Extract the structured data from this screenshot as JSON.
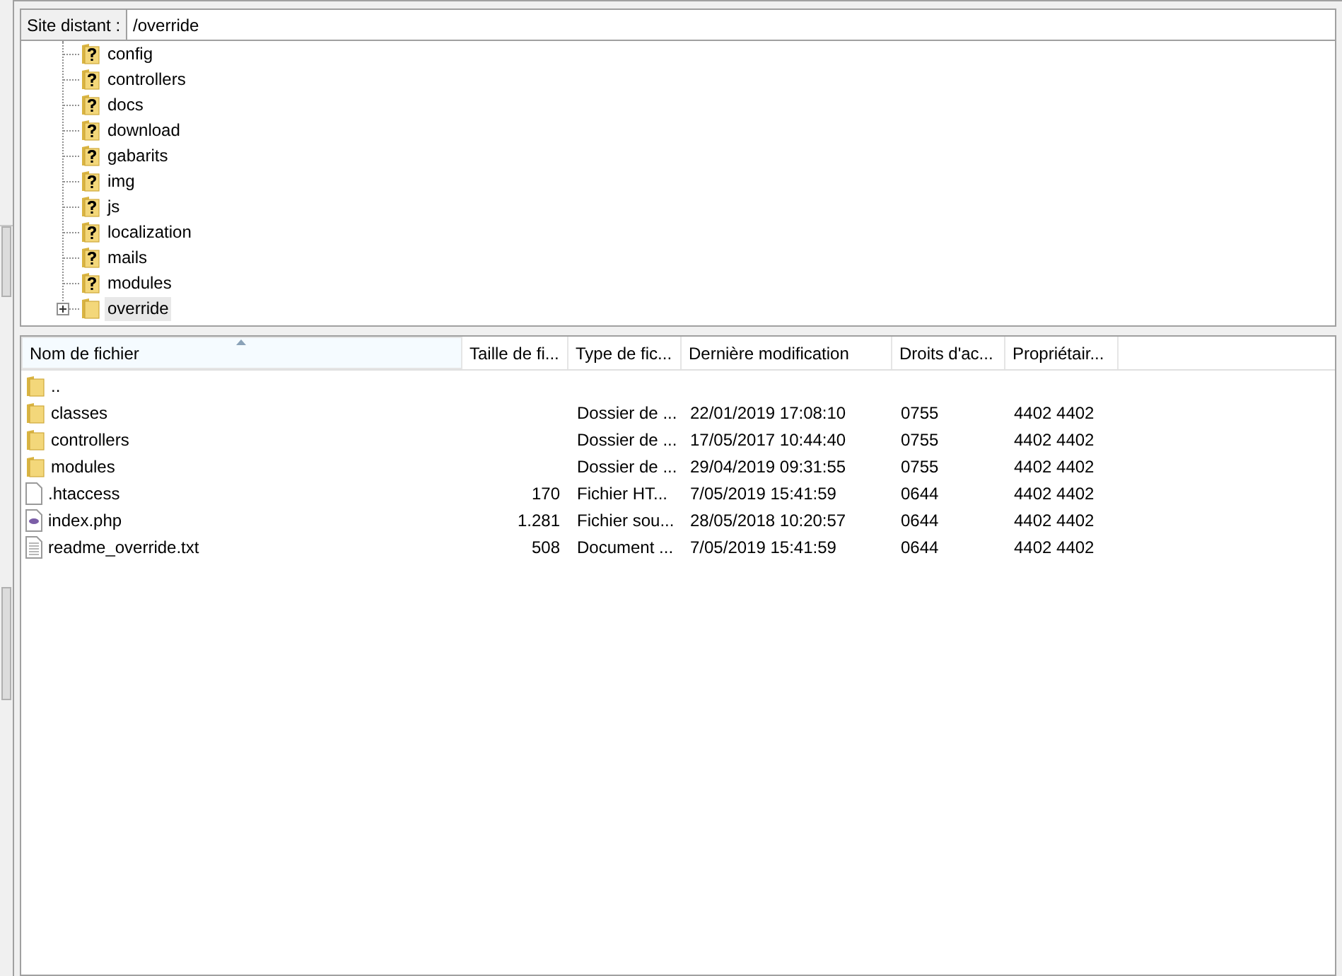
{
  "remote_site": {
    "label": "Site distant :",
    "path": "/override"
  },
  "tree": [
    {
      "name": "config",
      "kind": "unknown",
      "selected": false
    },
    {
      "name": "controllers",
      "kind": "unknown",
      "selected": false
    },
    {
      "name": "docs",
      "kind": "unknown",
      "selected": false
    },
    {
      "name": "download",
      "kind": "unknown",
      "selected": false
    },
    {
      "name": "gabarits",
      "kind": "unknown",
      "selected": false
    },
    {
      "name": "img",
      "kind": "unknown",
      "selected": false
    },
    {
      "name": "js",
      "kind": "unknown",
      "selected": false
    },
    {
      "name": "localization",
      "kind": "unknown",
      "selected": false
    },
    {
      "name": "mails",
      "kind": "unknown",
      "selected": false
    },
    {
      "name": "modules",
      "kind": "unknown",
      "selected": false
    },
    {
      "name": "override",
      "kind": "folder",
      "selected": true,
      "expandable": true
    }
  ],
  "file_list": {
    "columns": [
      {
        "label": "Nom de fichier",
        "sorted": true
      },
      {
        "label": "Taille de fi...",
        "sorted": false
      },
      {
        "label": "Type de fic...",
        "sorted": false
      },
      {
        "label": "Dernière modification",
        "sorted": false
      },
      {
        "label": "Droits d'ac...",
        "sorted": false
      },
      {
        "label": "Propriétair...",
        "sorted": false
      }
    ],
    "rows": [
      {
        "kind": "folder",
        "name": ".."
      },
      {
        "kind": "folder",
        "name": "classes",
        "type": "Dossier de ...",
        "modified": "22/01/2019 17:08:10",
        "rights": "0755",
        "owner": "4402 4402"
      },
      {
        "kind": "folder",
        "name": "controllers",
        "type": "Dossier de ...",
        "modified": "17/05/2017 10:44:40",
        "rights": "0755",
        "owner": "4402 4402"
      },
      {
        "kind": "folder",
        "name": "modules",
        "type": "Dossier de ...",
        "modified": "29/04/2019 09:31:55",
        "rights": "0755",
        "owner": "4402 4402"
      },
      {
        "kind": "file",
        "name": ".htaccess",
        "size": "170",
        "type": "Fichier HT...",
        "modified": "7/05/2019 15:41:59",
        "rights": "0644",
        "owner": "4402 4402"
      },
      {
        "kind": "php",
        "name": "index.php",
        "size": "1.281",
        "type": "Fichier sou...",
        "modified": "28/05/2018 10:20:57",
        "rights": "0644",
        "owner": "4402 4402"
      },
      {
        "kind": "text",
        "name": "readme_override.txt",
        "size": "508",
        "type": "Document ...",
        "modified": "7/05/2019 15:41:59",
        "rights": "0644",
        "owner": "4402 4402"
      }
    ]
  }
}
